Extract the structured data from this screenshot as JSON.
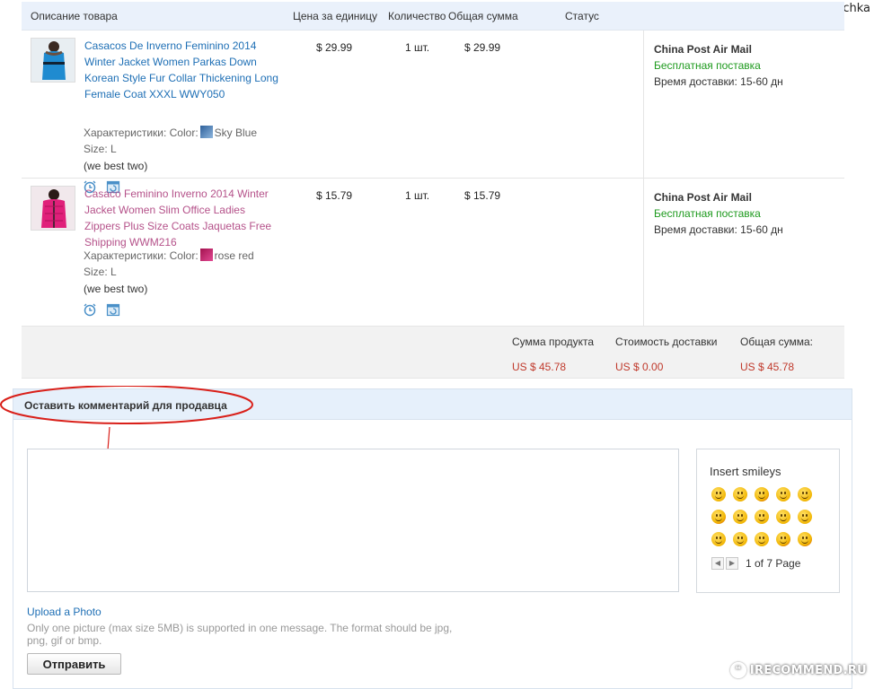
{
  "watermark_user": "Zaremochka",
  "header": {
    "col_description": "Описание товара",
    "col_unit_price": "Цена за единицу",
    "col_quantity": "Количество",
    "col_total": "Общая сумма",
    "col_status": "Статус"
  },
  "items": [
    {
      "title": "Casacos De Inverno Feminino 2014 Winter Jacket Women Parkas Down Korean Style Fur Collar Thickening Long Female Coat XXXL WWY050",
      "props_label": "Характеристики: Color:",
      "color_name": "Sky Blue",
      "size": "Size: L",
      "note": "(we best two)",
      "unit_price": "$ 29.99",
      "quantity": "1 шт.",
      "total": "$ 29.99",
      "carrier": "China Post Air Mail",
      "shipping": "Бесплатная поставка",
      "delivery_time": "Время доставки:  15-60 дн"
    },
    {
      "title": "Casaco Feminino Inverno 2014 Winter Jacket Women Slim Office Ladies Zippers Plus Size Coats Jaquetas Free Shipping WWM216",
      "props_label": "Характеристики: Color:",
      "color_name": "rose red",
      "size": "Size: L",
      "note": "(we best two)",
      "unit_price": "$ 15.79",
      "quantity": "1 шт.",
      "total": "$ 15.79",
      "carrier": "China Post Air Mail",
      "shipping": "Бесплатная поставка",
      "delivery_time": "Время доставки:  15-60 дн"
    }
  ],
  "totals": {
    "products_label": "Сумма продукта",
    "products_value": "US $ 45.78",
    "shipping_label": "Стоимость доставки",
    "shipping_value": "US $ 0.00",
    "grand_label": "Общая сумма:",
    "grand_value": "US $ 45.78"
  },
  "comment": {
    "title": "Оставить комментарий для продавца",
    "smileys_title": "Insert smileys",
    "pager_text": "1 of 7 Page",
    "upload_link": "Upload a Photo",
    "upload_hint": "Only one picture (max size 5MB) is supported in one message. The format should be jpg, png, gif or bmp.",
    "send_label": "Отправить"
  },
  "badge": "IRECOMMEND.RU",
  "colors": {
    "link": "#1e6fb5",
    "free_shipping": "#1e9a1e",
    "price_red": "#c0392b",
    "annotation_red": "#d9201a",
    "header_bg": "#eaf1fb"
  },
  "icons": [
    "alarm-clock-icon",
    "calendar-refresh-icon",
    "smiley-icon",
    "arrow-left-icon",
    "arrow-right-icon"
  ]
}
